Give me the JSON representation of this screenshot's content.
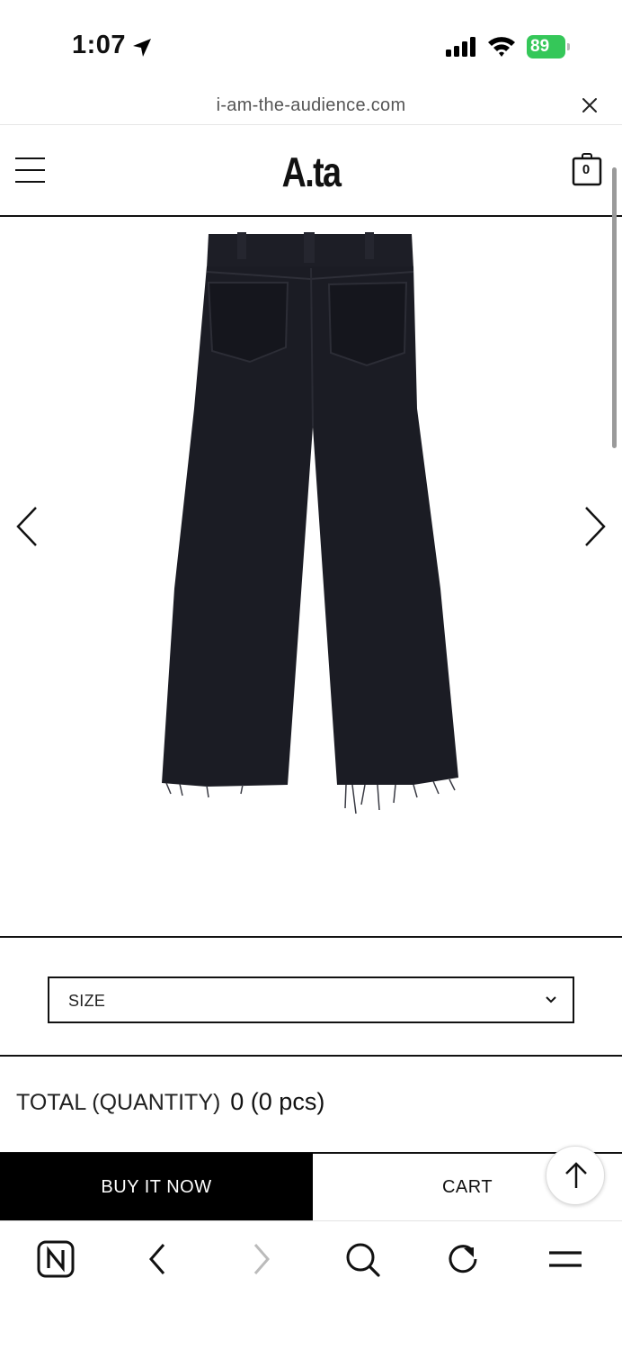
{
  "status_bar": {
    "time": "1:07",
    "battery_level": "89"
  },
  "browser": {
    "url": "i-am-the-audience.com"
  },
  "header": {
    "brand": "A.ta",
    "cart_count": "0"
  },
  "gallery": {
    "product_image": "black-wide-leg-pants-back-view"
  },
  "options": {
    "size_label": "SIZE"
  },
  "total": {
    "label": "TOTAL (QUANTITY)",
    "value": "0 (0 pcs)"
  },
  "actions": {
    "buy_now_label": "BUY IT NOW",
    "cart_label": "CART"
  },
  "toolbar": {
    "icons": [
      "naver-icon",
      "back-icon",
      "forward-icon",
      "search-icon",
      "reload-icon",
      "menu-icon"
    ]
  },
  "colors": {
    "battery": "#35c759",
    "primary": "#000000",
    "background": "#ffffff"
  }
}
